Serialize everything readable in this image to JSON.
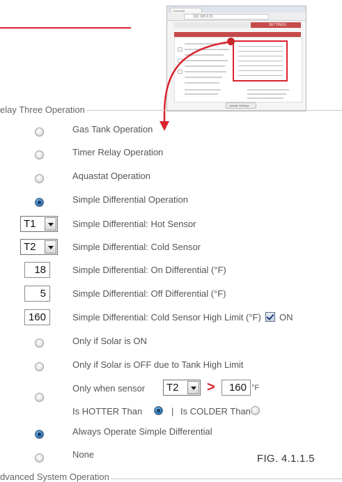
{
  "thumbnail": {
    "tab_title": "Controller",
    "url": "192.168.0.51",
    "settings_tab": "SETTINGS",
    "button_label": "Update Settings"
  },
  "section": {
    "title": "elay Three Operation"
  },
  "options": {
    "gas_tank": "Gas Tank Operation",
    "timer_relay": "Timer Relay Operation",
    "aquastat": "Aquastat Operation",
    "simple_diff": "Simple Differential Operation"
  },
  "hot_sensor": {
    "value": "T1",
    "label": "Simple Differential: Hot Sensor"
  },
  "cold_sensor": {
    "value": "T2",
    "label": "Simple Differential: Cold Sensor"
  },
  "on_diff": {
    "value": "18",
    "label": "Simple Differential: On Differential (°F)"
  },
  "off_diff": {
    "value": "5",
    "label": "Simple Differential: Off Differential (°F)"
  },
  "cold_high_limit": {
    "value": "160",
    "label": "Simple Differential: Cold Sensor High Limit (°F)",
    "on_label": "ON"
  },
  "conditions": {
    "solar_on": "Only if Solar is ON",
    "solar_off": "Only if Solar is OFF due to Tank High Limit",
    "sensor_prefix": "Only when sensor",
    "sensor_value": "T2",
    "gt_symbol": ">",
    "threshold": "160",
    "unit": "°F",
    "hotter_label": "Is HOTTER Than",
    "separator": "|",
    "colder_label": "Is COLDER Than",
    "always": "Always Operate Simple Differential",
    "none": "None"
  },
  "figure_label": "FIG. 4.1.1.5",
  "next_section": {
    "title": "dvanced System Operation"
  },
  "colors": {
    "accent": "#d9232e",
    "radio_selected": "#2f6fad"
  }
}
